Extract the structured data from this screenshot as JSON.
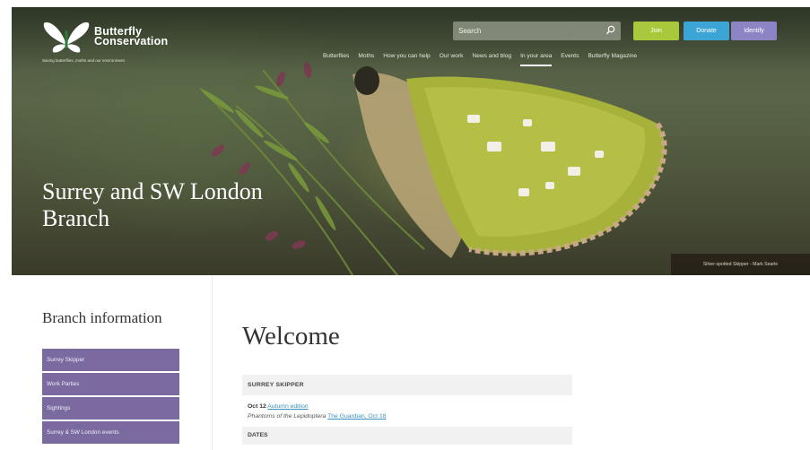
{
  "brand": {
    "name_line1": "Butterfly",
    "name_line2": "Conservation",
    "tagline": "Saving butterflies, moths and our environment"
  },
  "search": {
    "placeholder": "Search"
  },
  "header_buttons": {
    "join": "Join",
    "donate": "Donate",
    "identify": "Identify"
  },
  "nav": [
    {
      "label": "Butterflies"
    },
    {
      "label": "Moths"
    },
    {
      "label": "How you can help"
    },
    {
      "label": "Our work"
    },
    {
      "label": "News and blog"
    },
    {
      "label": "In your area",
      "active": true
    },
    {
      "label": "Events"
    },
    {
      "label": "Butterfly Magazine"
    }
  ],
  "hero": {
    "title_line1": "Surrey and SW London",
    "title_line2": "Branch",
    "caption": "Silver-spotted Skipper - Mark Searle"
  },
  "sidebar": {
    "title": "Branch information",
    "items": [
      {
        "label": "Surrey Skipper"
      },
      {
        "label": "Work Parties"
      },
      {
        "label": "Sightings"
      },
      {
        "label": "Surrey & SW London events"
      }
    ]
  },
  "main": {
    "heading": "Welcome",
    "section1_header": "SURREY SKIPPER",
    "row1_date": "Oct 12",
    "row1_link": "Autumn edition",
    "row2_text": "Phantoms of the Lepidoptera",
    "row2_link": "The Guardian, Oct 18",
    "section2_header": "DATES"
  },
  "colors": {
    "join": "#a9c93c",
    "donate": "#3da5d6",
    "identify": "#8c84c4",
    "sidebar_item": "#7a6aa0",
    "link": "#3c8fb9"
  }
}
